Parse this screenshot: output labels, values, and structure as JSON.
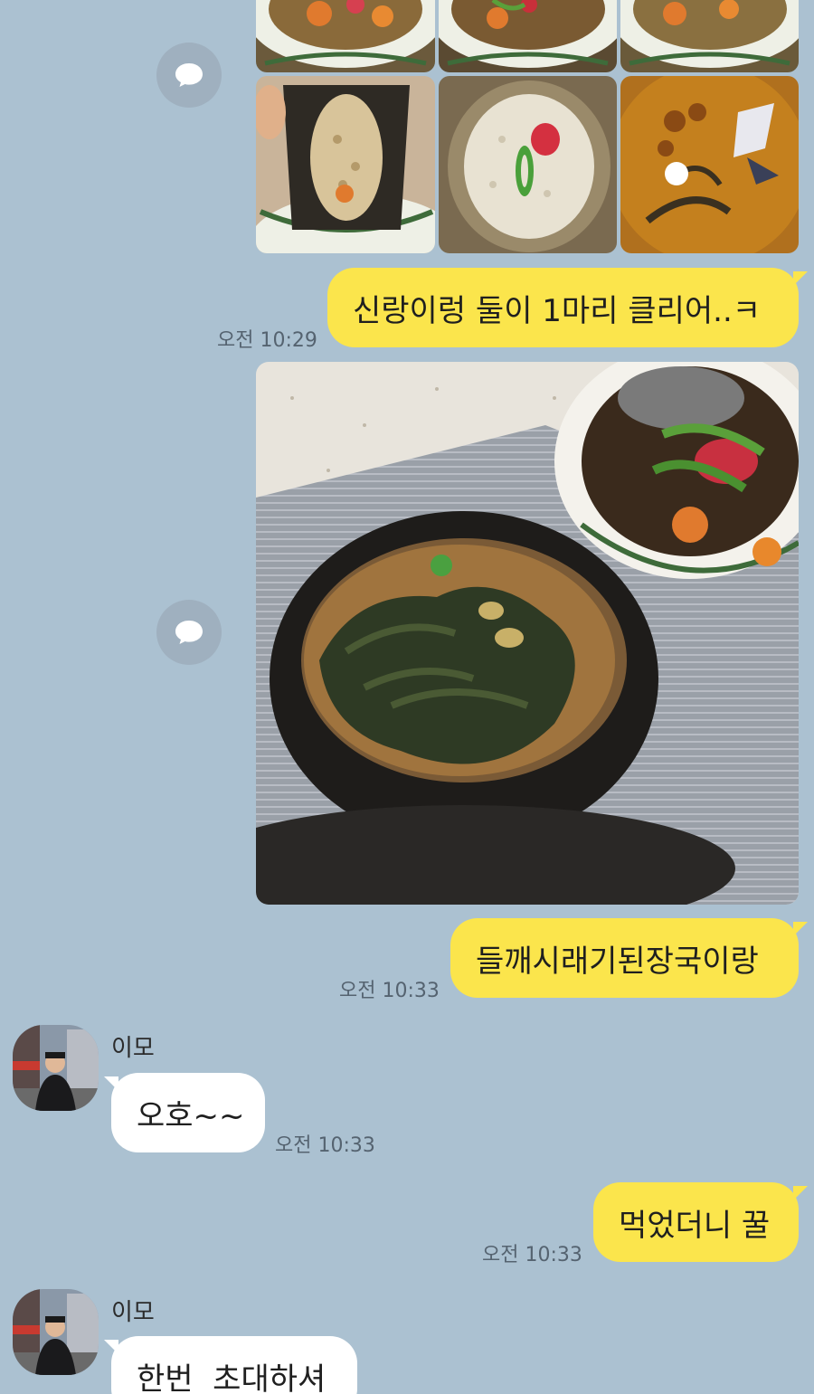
{
  "messages": [
    {
      "id": "m1",
      "from": "me",
      "time": "오전 10:29",
      "text": "신랑이렁 둘이 1마리 클리어..ㅋ"
    },
    {
      "id": "m2",
      "from": "me",
      "time": "오전 10:33",
      "text": "들깨시래기된장국이랑"
    },
    {
      "id": "m3",
      "from": "other",
      "sender": "이모",
      "time": "오전 10:33",
      "text": "오호~~"
    },
    {
      "id": "m4",
      "from": "me",
      "time": "오전 10:33",
      "text": "먹었더니 꿀"
    },
    {
      "id": "m5",
      "from": "other",
      "sender": "이모",
      "text": "한번  초대하셔"
    }
  ],
  "colors": {
    "background": "#abc1d1",
    "my_bubble": "#fbe54c",
    "other_bubble": "#ffffff"
  },
  "icons": {
    "share": "share-speech-icon"
  }
}
